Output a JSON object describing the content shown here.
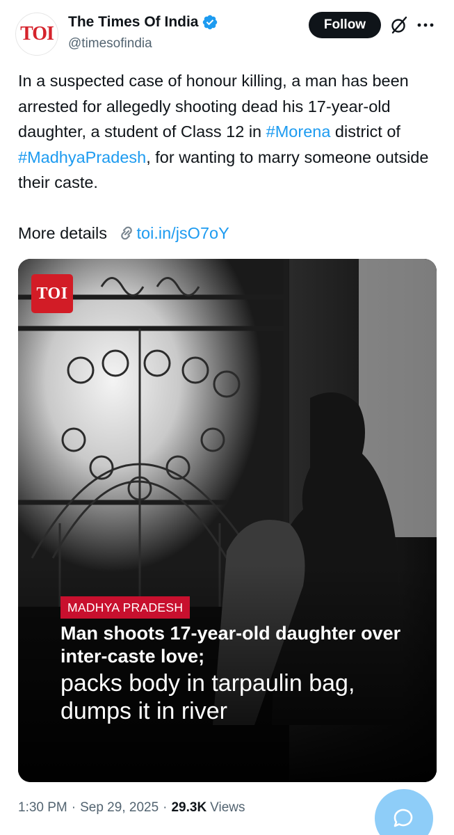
{
  "account": {
    "avatar_text": "TOI",
    "display_name": "The Times Of India",
    "handle": "@timesofindia",
    "follow_label": "Follow"
  },
  "tweet": {
    "text_part1": "In a suspected case of honour killing, a man has been arrested for allegedly shooting dead his 17-year-old daughter, a student of Class 12 in ",
    "hashtag1": "#Morena",
    "text_part2": " district of ",
    "hashtag2": "#MadhyaPradesh",
    "text_part3": ", for wanting to marry someone outside their caste.",
    "more_details": "More details ",
    "link": "toi.in/jsO7oY"
  },
  "media": {
    "badge_text": "TOI",
    "category": "MADHYA PRADESH",
    "headline_bold": "Man shoots 17-year-old daughter over inter-caste love;",
    "headline_light": "packs body in tarpaulin bag, dumps it in river"
  },
  "meta": {
    "time": "1:30 PM",
    "dot": "·",
    "date": "Sep 29, 2025",
    "views_count": "29.3K",
    "views_label": "Views"
  },
  "colors": {
    "link_blue": "#1d9bf0",
    "category_red": "#c8102e",
    "toi_red": "#d21c26",
    "fab_blue": "#8ecdf8"
  },
  "icons": [
    "verified-badge-icon",
    "grok-icon",
    "more-options-icon",
    "link-icon",
    "reply-compose-icon"
  ]
}
